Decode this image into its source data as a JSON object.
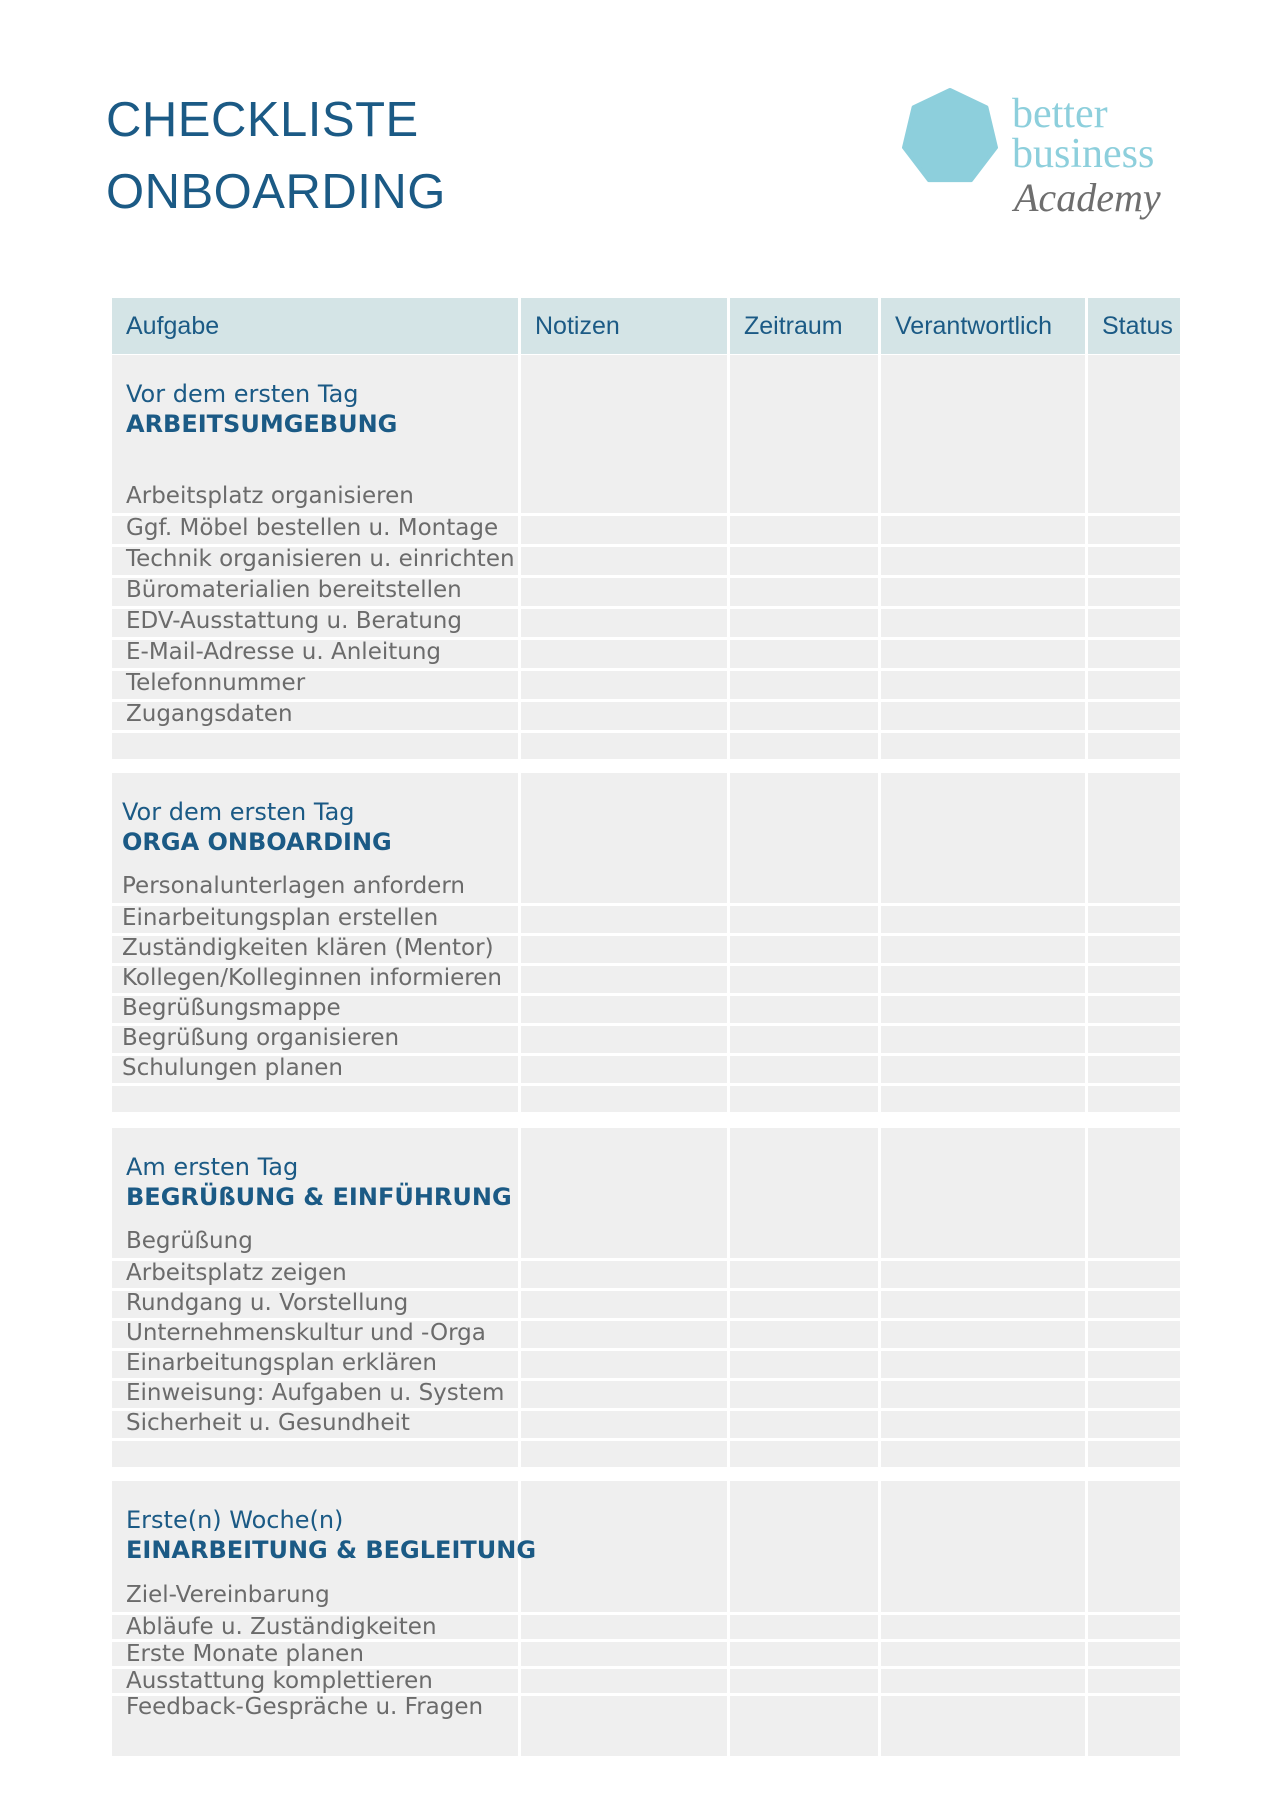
{
  "document": {
    "title_line1": "CHECKLISTE",
    "title_line2": "ONBOARDING"
  },
  "logo": {
    "icon": "heptagon-logo-icon",
    "line1": "better",
    "line2": "business",
    "line3": "Academy",
    "brand_color": "#8dcfdc",
    "secondary_color": "#6e6e6e"
  },
  "colors": {
    "heading": "#1b5a85",
    "header_bg": "#d4e4e6",
    "cell_bg": "#efefef",
    "task_text": "#6b6b6b"
  },
  "table": {
    "columns": [
      "Aufgabe",
      "Notizen",
      "Zeitraum",
      "Verantwortlich",
      "Status"
    ],
    "sections": [
      {
        "phase": "Vor dem ersten Tag",
        "title": "ARBEITSUMGEBUNG",
        "tasks": [
          "Arbeitsplatz organisieren",
          "Ggf. Möbel bestellen u. Montage",
          "Technik organisieren u. einrichten",
          "Büromaterialien bereitstellen",
          "EDV-Ausstattung u. Beratung",
          "E-Mail-Adresse u. Anleitung",
          "Telefonnummer",
          "Zugangsdaten"
        ]
      },
      {
        "phase": "Vor dem ersten Tag",
        "title": "ORGA ONBOARDING",
        "tasks": [
          "Personalunterlagen anfordern",
          "Einarbeitungsplan erstellen",
          "Zuständigkeiten klären (Mentor)",
          "Kollegen/Kolleginnen informieren",
          "Begrüßungsmappe",
          "Begrüßung organisieren",
          "Schulungen planen"
        ]
      },
      {
        "phase": "Am ersten Tag",
        "title": "BEGRÜßUNG & EINFÜHRUNG",
        "tasks": [
          "Begrüßung",
          "Arbeitsplatz zeigen",
          "Rundgang u. Vorstellung",
          "Unternehmenskultur und -Orga",
          "Einarbeitungsplan erklären",
          "Einweisung: Aufgaben u. System",
          "Sicherheit u. Gesundheit"
        ]
      },
      {
        "phase": "Erste(n) Woche(n)",
        "title": "EINARBEITUNG & BEGLEITUNG",
        "tasks": [
          "Ziel-Vereinbarung",
          "Abläufe u. Zuständigkeiten",
          "Erste Monate planen",
          "Ausstattung komplettieren",
          "Feedback-Gespräche u. Fragen"
        ]
      }
    ]
  }
}
